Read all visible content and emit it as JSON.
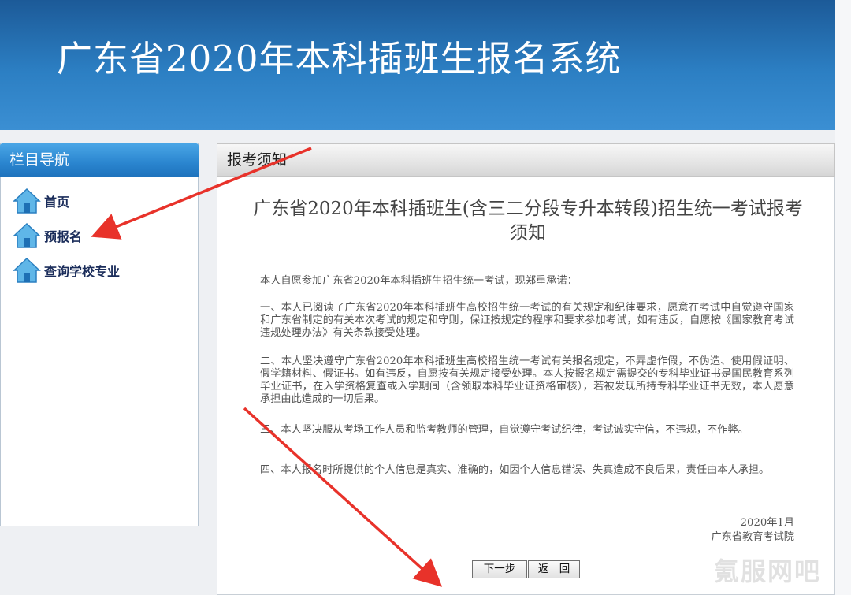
{
  "header": {
    "title": "广东省2020年本科插班生报名系统"
  },
  "sidebar": {
    "title": "栏目导航",
    "items": [
      {
        "label": "首页",
        "icon": "house-icon"
      },
      {
        "label": "预报名",
        "icon": "house-icon"
      },
      {
        "label": "查询学校专业",
        "icon": "house-icon"
      }
    ]
  },
  "main": {
    "panel_title": "报考须知",
    "notice_title": "广东省2020年本科插班生(含三二分段专升本转段)招生统一考试报考须知",
    "paragraphs": [
      "本人自愿参加广东省2020年本科插班生招生统一考试，现郑重承诺：",
      "一、本人已阅读了广东省2020年本科插班生高校招生统一考试的有关规定和纪律要求，愿意在考试中自觉遵守国家和广东省制定的有关本次考试的规定和守则，保证按规定的程序和要求参加考试，如有违反，自愿按《国家教育考试违规处理办法》有关条款接受处理。",
      "二、本人坚决遵守广东省2020年本科插班生高校招生统一考试有关报名规定，不弄虚作假，不伪造、使用假证明、假学籍材料、假证书。如有违反，自愿按有关规定接受处理。本人按报名规定需提交的专科毕业证书是国民教育系列毕业证书，在入学资格复查或入学期间（含领取本科毕业证资格审核），若被发现所持专科毕业证书无效，本人愿意承担由此造成的一切后果。",
      "三、本人坚决服从考场工作人员和监考教师的管理，自觉遵守考试纪律，考试诚实守信，不违规，不作弊。",
      "四、本人报名时所提供的个人信息是真实、准确的，如因个人信息错误、失真造成不良后果，责任由本人承担。"
    ],
    "date": "2020年1月",
    "issuer": "广东省教育考试院",
    "buttons": {
      "next": "下一步",
      "back": "返　回"
    }
  },
  "watermark": "氪服网吧",
  "colors": {
    "banner": "#2c7fc3",
    "nav_header": "#2a85cf",
    "arrow": "#e8322a"
  }
}
